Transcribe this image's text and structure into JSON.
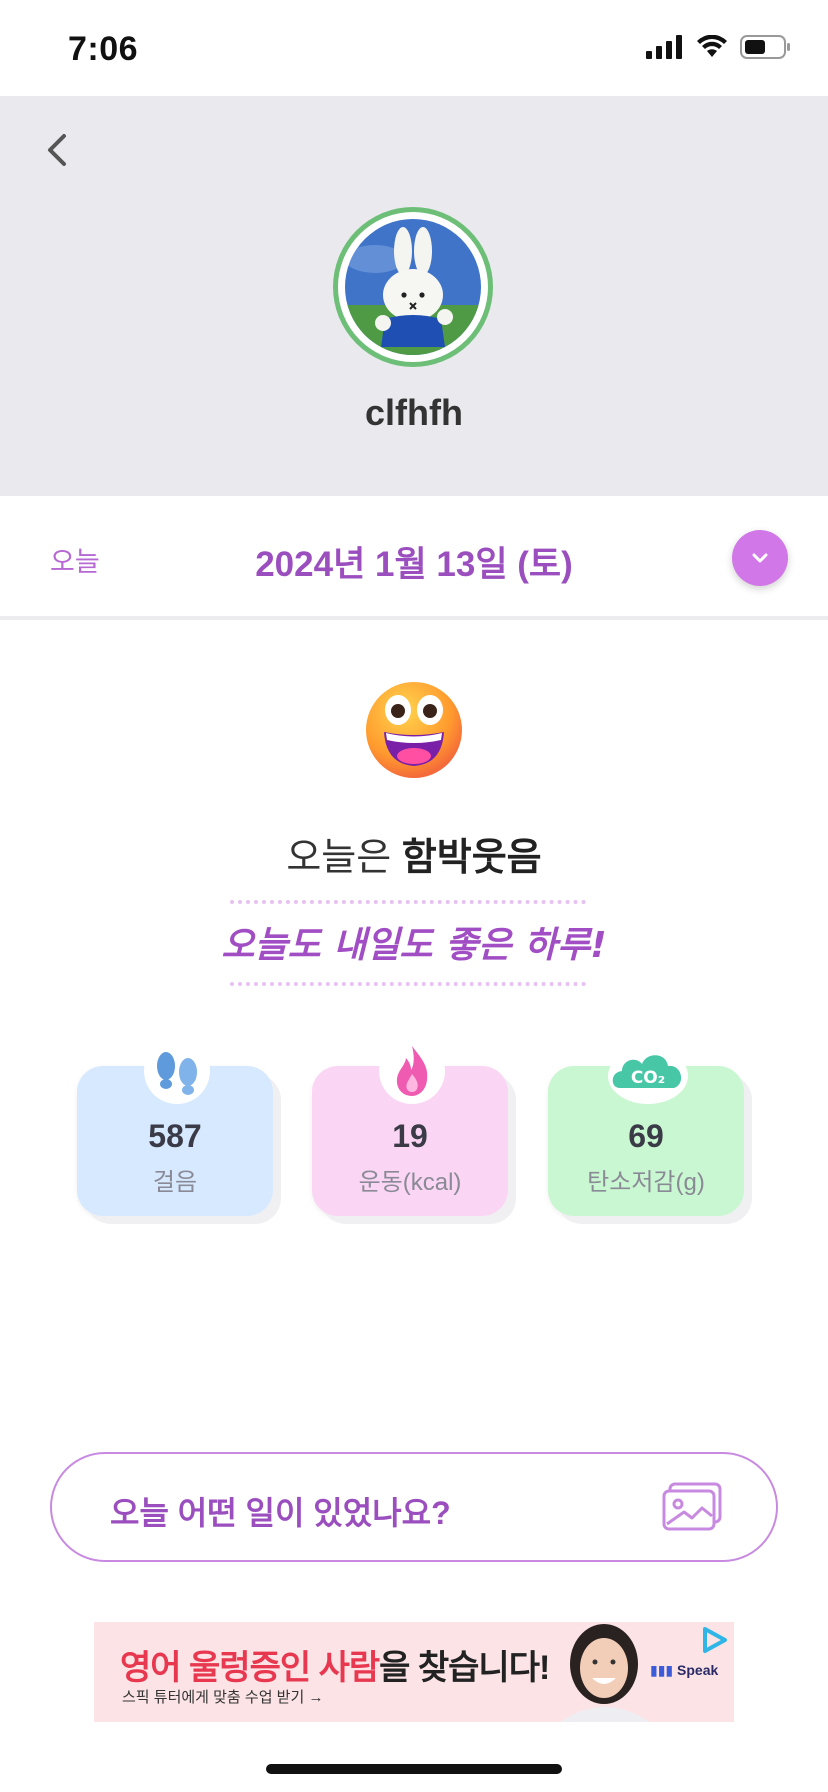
{
  "status_bar": {
    "time": "7:06"
  },
  "profile": {
    "username": "clfhfh"
  },
  "date_bar": {
    "today_label": "오늘",
    "date": "2024년 1월 13일 (토)"
  },
  "mood": {
    "prefix": "오늘은 ",
    "value": "함박웃음",
    "motto": "오늘도 내일도 좋은 하루!"
  },
  "stats": [
    {
      "value": "587",
      "label": "걸음",
      "color": "#d6e9ff",
      "icon": "footprints-icon"
    },
    {
      "value": "19",
      "label": "운동(kcal)",
      "color": "#fbd6f4",
      "icon": "flame-icon"
    },
    {
      "value": "69",
      "label": "탄소저감(g)",
      "color": "#c9f7d1",
      "icon": "co2-cloud-icon",
      "icon_text": "CO₂"
    }
  ],
  "input": {
    "placeholder": "오늘 어떤 일이 있었나요?"
  },
  "ad": {
    "title_highlight": "영어 울렁증인 사람",
    "title_rest": "을 찾습니다!",
    "subtitle": "스픽 튜터에게 맞춤 수업 받기 →",
    "brand": "Speak"
  },
  "colors": {
    "accent": "#9b4fbf",
    "header_bg": "#e9e9ee",
    "ring": "#6dbf78"
  }
}
